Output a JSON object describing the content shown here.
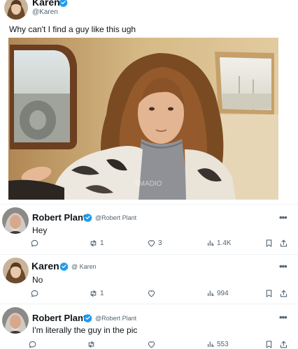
{
  "colors": {
    "verified": "#1d9bf0",
    "text": "#0f1419",
    "muted": "#536471",
    "divider": "#eff3f4"
  },
  "original_post": {
    "author_name": "Karen",
    "author_handle": "@Karen",
    "text": "Why can't I find a guy like this ugh",
    "image": {
      "subject": "long-haired man in fur coat seated in car",
      "watermark": "SMADIO"
    }
  },
  "replies": [
    {
      "author_name": "Robert Plant",
      "author_handle": "@Robert Plant",
      "text": "Hey",
      "stats": {
        "replies": "",
        "reposts": "1",
        "likes": "3",
        "views": "1.4K"
      }
    },
    {
      "author_name": "Karen",
      "author_handle": "@ Karen",
      "text": "No",
      "stats": {
        "replies": "",
        "reposts": "1",
        "likes": "",
        "views": "994"
      }
    },
    {
      "author_name": "Robert Plant",
      "author_handle": "@Robert Plant",
      "text": "I'm literally the guy in the pic",
      "stats": {
        "replies": "",
        "reposts": "",
        "likes": "",
        "views": "553"
      }
    }
  ],
  "icons": {
    "more": "more-dots-icon",
    "reply": "reply-icon",
    "repost": "repost-icon",
    "like": "heart-icon",
    "views": "views-chart-icon",
    "bookmark": "bookmark-icon",
    "share": "share-icon",
    "verified": "verified-badge-icon"
  },
  "more_label": "•••"
}
